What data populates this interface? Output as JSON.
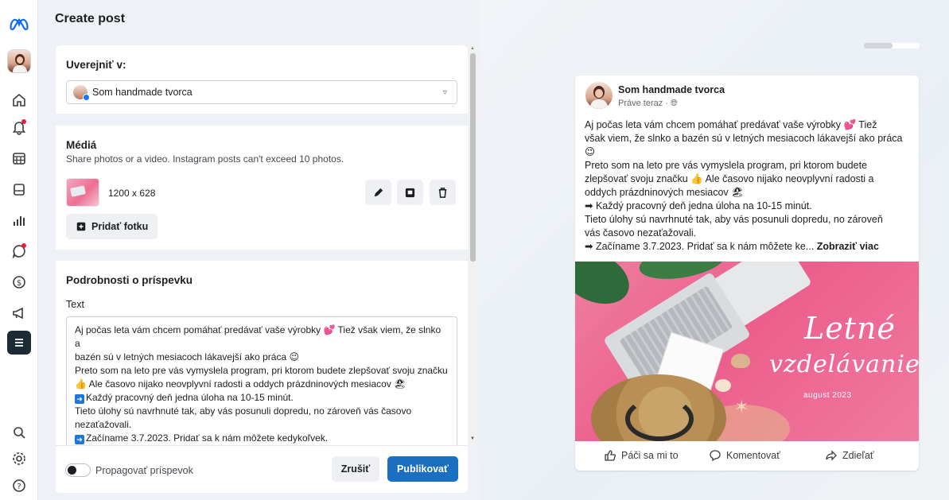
{
  "header": {
    "title": "Create post"
  },
  "publish_to": {
    "label": "Uverejniť v:",
    "selected": "Som handmade tvorca"
  },
  "media": {
    "title": "Médiá",
    "helper": "Share photos or a video. Instagram posts can't exceed 10 photos.",
    "dimensions": "1200 x 628",
    "add_photo_label": "Pridať fotku"
  },
  "details": {
    "title": "Podrobnosti o príspevku",
    "text_label": "Text",
    "text_lines": [
      "Aj počas leta vám chcem pomáhať predávať vaše výrobky 💕 Tiež však viem, že slnko a",
      "bazén sú v letných mesiacoch lákavejší ako práca 😉",
      "Preto som na leto pre vás vymyslela program, pri ktorom budete zlepšovať svoju značku",
      "👍 Ale časovo nijako neovplyvní radosti a oddych prázdninových mesiacov 🏖",
      "Každý pracovný deň jedna úloha na 10-15 minút.",
      "Tieto úlohy sú navrhnuté tak, aby vás posunuli dopredu, no zároveň vás časovo",
      "nezaťažovali.",
      "Začíname 3.7.2023. Pridať sa k nám môžete kedykoľvek."
    ]
  },
  "footer": {
    "boost_label": "Propagovať príspevok",
    "cancel_label": "Zrušiť",
    "publish_label": "Publikovať"
  },
  "preview": {
    "page_name": "Som handmade tvorca",
    "timestamp": "Práve teraz · ",
    "text_lines": [
      "Aj počas leta vám chcem pomáhať predávať vaše výrobky 💕 Tiež",
      "však viem, že slnko a bazén sú v letných mesiacoch lákavejší ako práca",
      "😉",
      "Preto som na leto pre vás vymyslela program, pri ktorom budete",
      "zlepšovať svoju značku 👍 Ale časovo nijako neovplyvní radosti a",
      "oddych prázdninových mesiacov 🏖",
      "➡ Každý pracovný deň jedna úloha na 10-15 minút.",
      "Tieto úlohy sú navrhnuté tak, aby vás posunuli dopredu, no zároveň",
      "vás časovo nezaťažovali.",
      "➡ Začíname 3.7.2023. Pridať sa k nám môžete ke..."
    ],
    "see_more": "Zobraziť viac",
    "image_text": {
      "line1": "Letné",
      "line2": "vzdelávanie",
      "line3": "august 2023"
    },
    "actions": {
      "like": "Páči sa mi to",
      "comment": "Komentovať",
      "share": "Zdieľať"
    }
  },
  "colors": {
    "publish_button": "#1a6fc0",
    "accent_blue": "#1877f2",
    "notification_dot": "#e41e3f",
    "active_nav": "#1c2b33"
  },
  "icons": {
    "rail": [
      "meta-logo-icon",
      "home-icon",
      "notifications-icon",
      "planner-icon",
      "content-icon",
      "insights-icon",
      "inbox-icon",
      "monetization-icon",
      "ads-icon",
      "menu-icon",
      "search-icon",
      "settings-icon",
      "help-icon"
    ]
  }
}
